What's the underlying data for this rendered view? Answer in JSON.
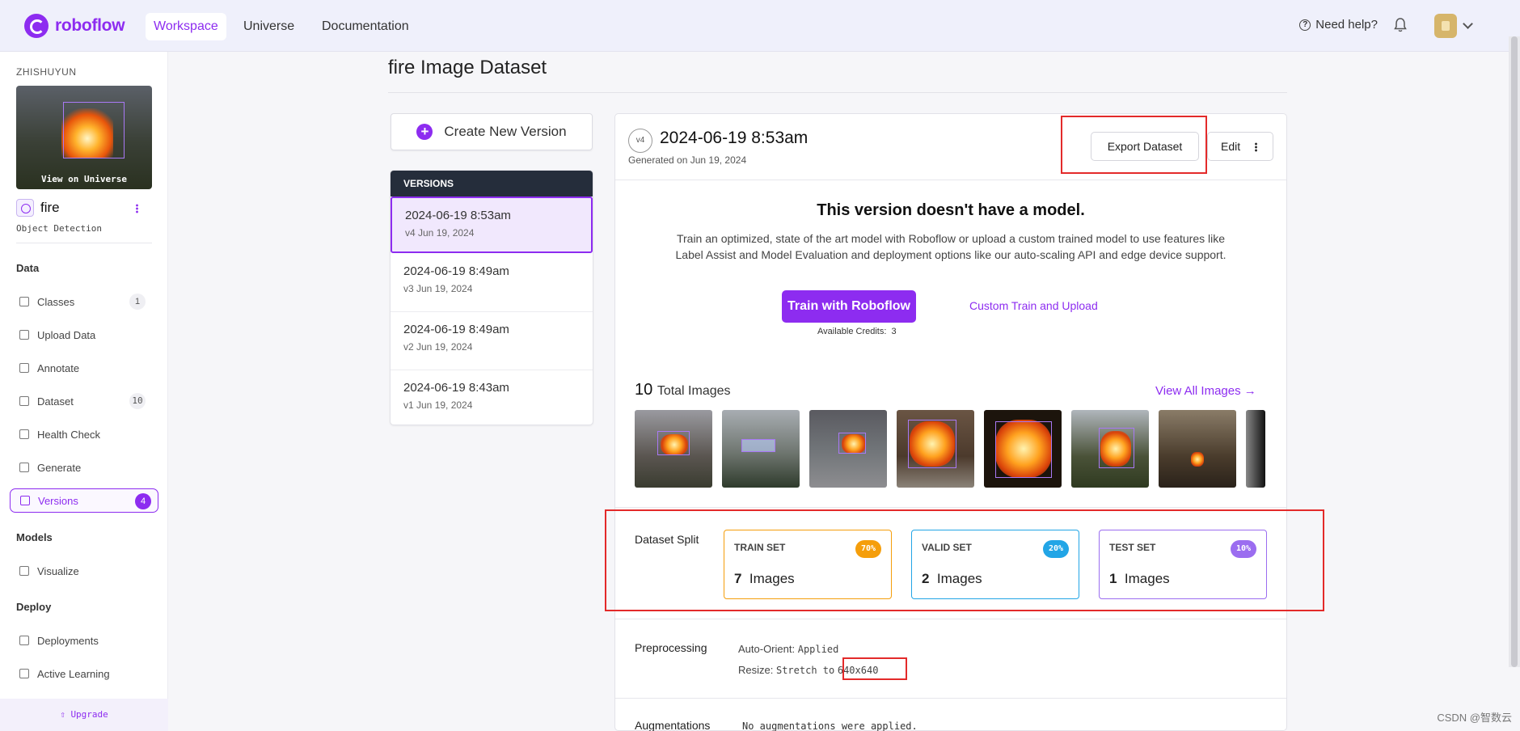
{
  "nav": {
    "brand": "roboflow",
    "tabs": [
      "Workspace",
      "Universe",
      "Documentation"
    ],
    "help": "Need help?"
  },
  "sidebar": {
    "workspace": "ZHISHUYUN",
    "thumb_caption": "View on Universe",
    "project_name": "fire",
    "project_type": "Object Detection",
    "sections": {
      "data": "Data",
      "models": "Models",
      "deploy": "Deploy"
    },
    "items": [
      {
        "label": "Classes",
        "count": "1"
      },
      {
        "label": "Upload Data",
        "count": ""
      },
      {
        "label": "Annotate",
        "count": ""
      },
      {
        "label": "Dataset",
        "count": "10"
      },
      {
        "label": "Health Check",
        "count": ""
      },
      {
        "label": "Generate",
        "count": ""
      },
      {
        "label": "Versions",
        "count": "4"
      },
      {
        "label": "Visualize",
        "count": ""
      },
      {
        "label": "Deployments",
        "count": ""
      },
      {
        "label": "Active Learning",
        "count": ""
      }
    ],
    "upgrade": "Upgrade"
  },
  "main": {
    "title": "fire Image Dataset",
    "create_button": "Create New Version",
    "versions_header": "VERSIONS",
    "versions": [
      {
        "date": "2024-06-19 8:53am",
        "sub": "v4 Jun 19, 2024"
      },
      {
        "date": "2024-06-19 8:49am",
        "sub": "v3 Jun 19, 2024"
      },
      {
        "date": "2024-06-19 8:49am",
        "sub": "v2 Jun 19, 2024"
      },
      {
        "date": "2024-06-19 8:43am",
        "sub": "v1 Jun 19, 2024"
      }
    ]
  },
  "card": {
    "badge": "v4",
    "title": "2024-06-19 8:53am",
    "generated": "Generated on Jun 19, 2024",
    "export": "Export Dataset",
    "edit": "Edit",
    "no_model_title": "This version doesn't have a model.",
    "no_model_desc": "Train an optimized, state of the art model with Roboflow or upload a custom trained model to use features like Label Assist and Model Evaluation and deployment options like our auto-scaling API and edge device support.",
    "train_button": "Train with Roboflow",
    "custom_link": "Custom Train and Upload",
    "credits_label": "Available Credits:",
    "credits_value": "3",
    "total_count": "10",
    "total_label": "Total Images",
    "view_all": "View All Images →",
    "split_label": "Dataset Split",
    "splits": [
      {
        "name": "TRAIN SET",
        "pct": "70%",
        "count": "7",
        "unit": "Images",
        "color": "#f59e0b"
      },
      {
        "name": "VALID SET",
        "pct": "20%",
        "count": "2",
        "unit": "Images",
        "color": "#22a5e6"
      },
      {
        "name": "TEST SET",
        "pct": "10%",
        "count": "1",
        "unit": "Images",
        "color": "#9b6df0"
      }
    ],
    "preprocessing_label": "Preprocessing",
    "auto_orient_key": "Auto-Orient:",
    "auto_orient_val": "Applied",
    "resize_key": "Resize:",
    "resize_val": "Stretch to",
    "resize_size": "640x640",
    "augmentations_label": "Augmentations",
    "augmentations_val": "No augmentations were applied."
  },
  "watermark": "CSDN @智数云",
  "colors": {
    "accent": "#8d2cf0",
    "highlight": "#e32a2a"
  }
}
